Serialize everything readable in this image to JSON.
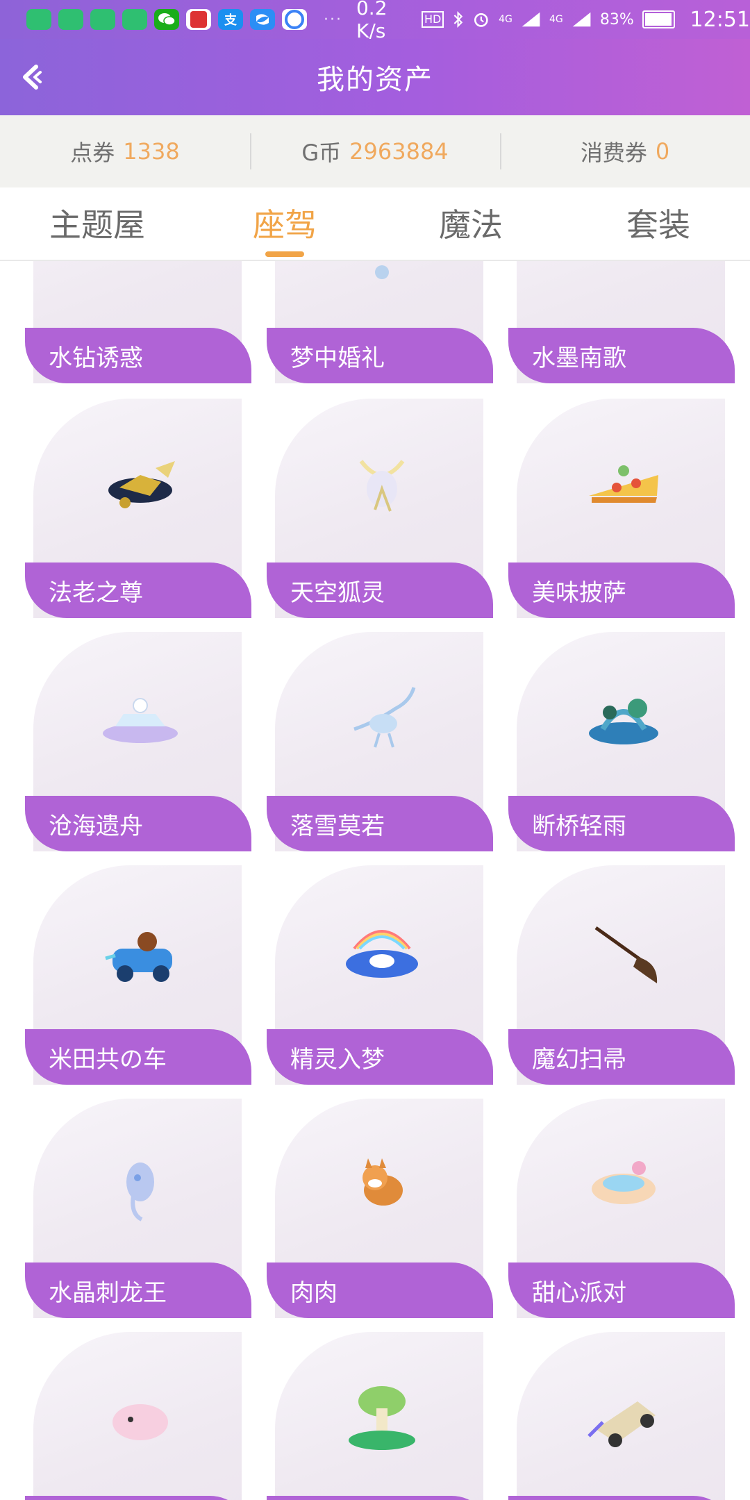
{
  "status_bar": {
    "speed": "0.2 K/s",
    "hd_badge": "HD",
    "network_1": "4G",
    "network_2": "4G",
    "battery": "83%",
    "time": "12:51",
    "app_icons": [
      "chat-app-icon",
      "chat-app-icon",
      "chat-app-icon",
      "chat-app-icon",
      "wechat-icon",
      "news-app-icon",
      "alipay-icon",
      "app-icon",
      "browser-icon"
    ],
    "alipay_glyph": "支"
  },
  "header": {
    "title": "我的资产"
  },
  "balances": [
    {
      "label": "点券",
      "value": "1338"
    },
    {
      "label": "G币",
      "value": "2963884"
    },
    {
      "label": "消费券",
      "value": "0"
    }
  ],
  "tabs": [
    {
      "label": "主题屋",
      "active": false
    },
    {
      "label": "座驾",
      "active": true
    },
    {
      "label": "魔法",
      "active": false
    },
    {
      "label": "套装",
      "active": false
    }
  ],
  "colors": {
    "accent": "#f1a447",
    "label_purple": "#b063d6",
    "header_purple": "#a45ede"
  },
  "items": [
    {
      "name": "水钻诱惑"
    },
    {
      "name": "梦中婚礼"
    },
    {
      "name": "水墨南歌"
    },
    {
      "name": "法老之尊"
    },
    {
      "name": "天空狐灵"
    },
    {
      "name": "美味披萨"
    },
    {
      "name": "沧海遗舟"
    },
    {
      "name": "落雪莫若"
    },
    {
      "name": "断桥轻雨"
    },
    {
      "name": "米田共の车"
    },
    {
      "name": "精灵入梦"
    },
    {
      "name": "魔幻扫帚"
    },
    {
      "name": "水晶刺龙王"
    },
    {
      "name": "肉肉"
    },
    {
      "name": "甜心派对"
    },
    {
      "name": ""
    },
    {
      "name": ""
    },
    {
      "name": ""
    }
  ]
}
